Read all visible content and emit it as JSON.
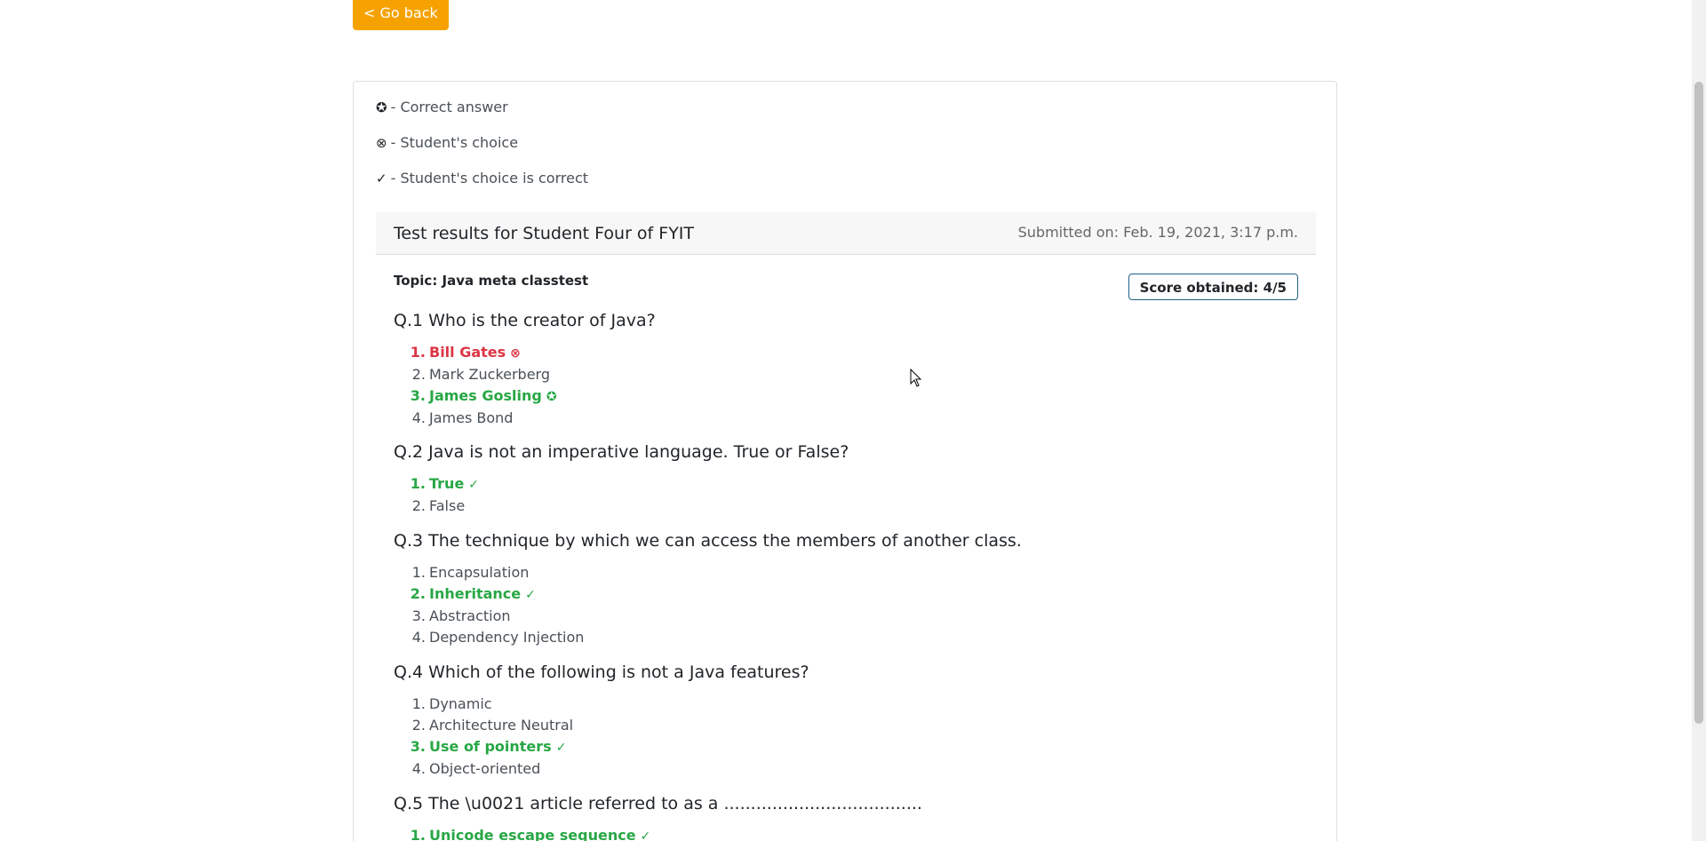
{
  "nav": {
    "go_back_label": "< Go back"
  },
  "legend": [
    {
      "symbol": "✪",
      "text": "- Correct answer"
    },
    {
      "symbol": "⊗",
      "text": "- Student's choice"
    },
    {
      "symbol": "✓",
      "text": "- Student's choice is correct"
    }
  ],
  "results": {
    "title": "Test results for Student Four of FYIT",
    "submitted": "Submitted on: Feb. 19, 2021, 3:17 p.m.",
    "topic": "Topic: Java meta classtest",
    "score": "Score obtained: 4/5"
  },
  "questions": [
    {
      "text": "Q.1 Who is the creator of Java?",
      "options": [
        {
          "num": "1.",
          "text": "Bill Gates",
          "state": "wrong",
          "mark": "⊗"
        },
        {
          "num": "2.",
          "text": "Mark Zuckerberg",
          "state": "normal",
          "mark": ""
        },
        {
          "num": "3.",
          "text": "James Gosling",
          "state": "right",
          "mark": "✪"
        },
        {
          "num": "4.",
          "text": "James Bond",
          "state": "normal",
          "mark": ""
        }
      ]
    },
    {
      "text": "Q.2 Java is not an imperative language. True or False?",
      "options": [
        {
          "num": "1.",
          "text": "True",
          "state": "right",
          "mark": "✓"
        },
        {
          "num": "2.",
          "text": "False",
          "state": "normal",
          "mark": ""
        }
      ]
    },
    {
      "text": "Q.3 The technique by which we can access the members of another class.",
      "options": [
        {
          "num": "1.",
          "text": "Encapsulation",
          "state": "normal",
          "mark": ""
        },
        {
          "num": "2.",
          "text": "Inheritance",
          "state": "right",
          "mark": "✓"
        },
        {
          "num": "3.",
          "text": "Abstraction",
          "state": "normal",
          "mark": ""
        },
        {
          "num": "4.",
          "text": "Dependency Injection",
          "state": "normal",
          "mark": ""
        }
      ]
    },
    {
      "text": "Q.4 Which of the following is not a Java features?",
      "options": [
        {
          "num": "1.",
          "text": "Dynamic",
          "state": "normal",
          "mark": ""
        },
        {
          "num": "2.",
          "text": "Architecture Neutral",
          "state": "normal",
          "mark": ""
        },
        {
          "num": "3.",
          "text": "Use of pointers",
          "state": "right",
          "mark": "✓"
        },
        {
          "num": "4.",
          "text": "Object-oriented",
          "state": "normal",
          "mark": ""
        }
      ]
    },
    {
      "text": "Q.5 The \\u0021 article referred to as a .....................................",
      "options": [
        {
          "num": "1.",
          "text": "Unicode escape sequence",
          "state": "right",
          "mark": "✓"
        }
      ]
    }
  ],
  "colors": {
    "button": "#f5a200",
    "wrong": "#dc3545",
    "right": "#28a745",
    "score_border": "#1f5f86"
  }
}
